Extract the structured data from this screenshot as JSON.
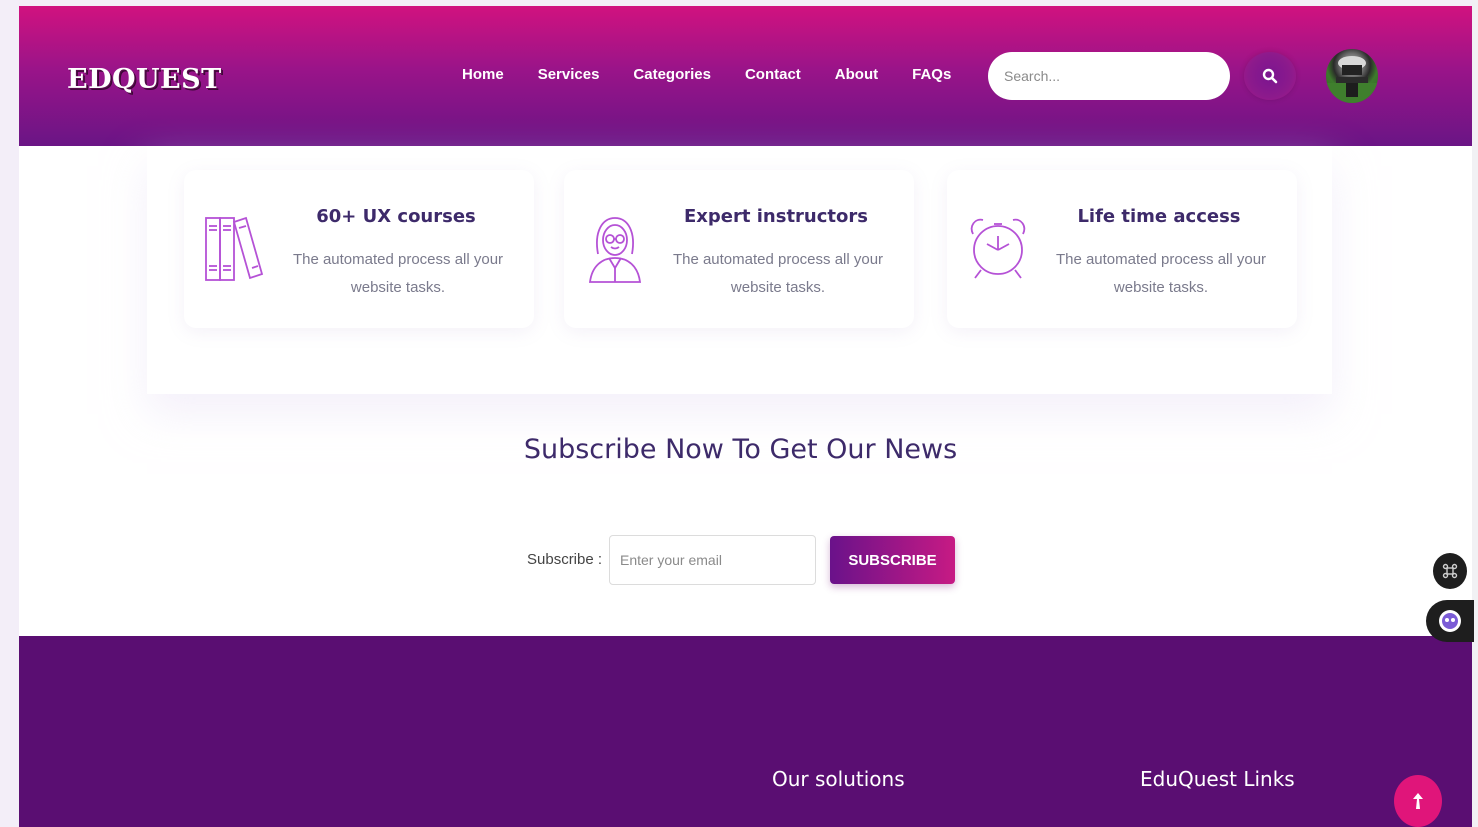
{
  "header": {
    "logo": "EDQUEST",
    "nav": [
      "Home",
      "Services",
      "Categories",
      "Contact",
      "About",
      "FAQs"
    ],
    "search": {
      "placeholder": "Search..."
    }
  },
  "features": [
    {
      "icon": "books-icon",
      "title": "60+ UX courses",
      "text": "The automated process all your website tasks."
    },
    {
      "icon": "instructor-icon",
      "title": "Expert instructors",
      "text": "The automated process all your website tasks."
    },
    {
      "icon": "alarm-clock-icon",
      "title": "Life time access",
      "text": "The automated process all your website tasks."
    }
  ],
  "subscribe": {
    "title": "Subscribe Now To Get Our News",
    "label": "Subscribe :",
    "placeholder": "Enter your email",
    "button": "SUBSCRIBE"
  },
  "footer": {
    "col1": "Our solutions",
    "col2": "EduQuest Links"
  },
  "colors": {
    "header_top": "#d1127f",
    "header_bottom": "#6a1585",
    "footer": "#5a0e72",
    "title_text": "#3d2a6a",
    "icon_purple": "#b552d6",
    "scroll_top": "#e0157a"
  }
}
